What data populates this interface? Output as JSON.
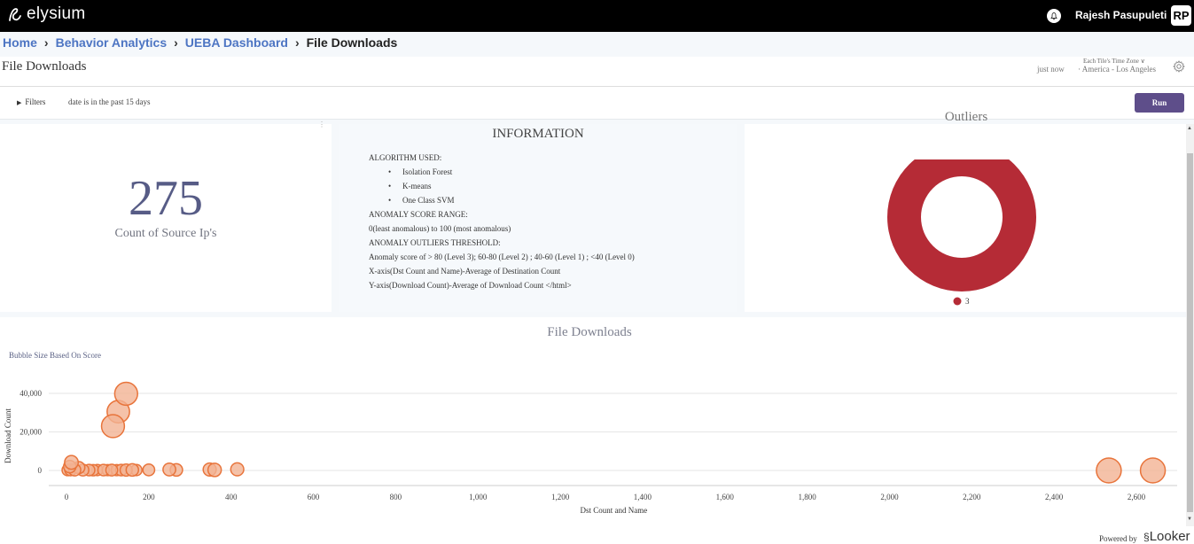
{
  "app": {
    "name": "elysium",
    "user_name": "Rajesh Pasupuleti",
    "user_initials": "RP"
  },
  "breadcrumb": [
    {
      "label": "Home"
    },
    {
      "label": "Behavior Analytics"
    },
    {
      "label": "UEBA Dashboard"
    },
    {
      "label": "File Downloads"
    }
  ],
  "breadcrumb_separator": "›",
  "dashboard": {
    "title": "File Downloads",
    "tz_label": "Each Tile's Time Zone ∨",
    "updated": "just now",
    "tz_value": "·  America - Los Angeles"
  },
  "filters": {
    "toggle_label": "Filters",
    "summary": "date is in the past 15 days",
    "run_label": "Run"
  },
  "kpi": {
    "value": "275",
    "label": "Count of Source Ip's"
  },
  "info": {
    "title": "INFORMATION",
    "algo_heading": "ALGORITHM USED:",
    "algorithms": [
      "Isolation Forest",
      "K-means",
      "One Class SVM"
    ],
    "range_heading": "ANOMALY SCORE RANGE:",
    "range_text": "0(least anomalous) to 100 (most anomalous)",
    "threshold_heading": "ANOMALY OUTLIERS THRESHOLD:",
    "threshold_text": "Anomaly score of > 80 (Level 3); 60-80 (Level 2) ; 40-60 (Level 1) ; <40 (Level 0)",
    "x_axis_text": "X-axis(Dst Count and Name)-Average of Destination Count",
    "y_axis_text": "Y-axis(Download Count)-Average of Download Count </html>"
  },
  "outliers": {
    "title": "Outliers"
  },
  "scatter": {
    "title": "File Downloads",
    "bubble_note": "Bubble Size Based On Score"
  },
  "footer": {
    "powered_by": "Powered by",
    "brand": "Looker"
  },
  "colors": {
    "topbar": "#000000",
    "link": "#4d75c3",
    "run": "#5e4e8a",
    "donut": "#b52b36",
    "bubble_fill": "#f3b394",
    "bubble_stroke": "#e8743b",
    "kpi": "#575c86"
  },
  "chart_data": [
    {
      "type": "pie",
      "title": "Outliers",
      "categories": [
        "3"
      ],
      "values": [
        1
      ],
      "legend_position": "bottom"
    },
    {
      "type": "scatter",
      "title": "File Downloads",
      "xlabel": "Dst Count and Name",
      "ylabel": "Download Count",
      "x_ticks": [
        0,
        200,
        400,
        600,
        800,
        1000,
        1200,
        1400,
        1600,
        1800,
        2000,
        2200,
        2400,
        2600
      ],
      "x_tick_labels": [
        "0",
        "200",
        "400",
        "600",
        "800",
        "1,000",
        "1,200",
        "1,400",
        "1,600",
        "1,800",
        "2,000",
        "2,200",
        "2,400",
        "2,600"
      ],
      "y_ticks": [
        0,
        20000,
        40000
      ],
      "y_tick_labels": [
        "0",
        "20,000",
        "40,000"
      ],
      "xlim": [
        -10,
        2700
      ],
      "ylim": [
        -4000,
        46000
      ],
      "grid": true,
      "size_encoding": "score",
      "points": [
        {
          "x": 145,
          "y": 39800,
          "s": 88
        },
        {
          "x": 126,
          "y": 30500,
          "s": 85
        },
        {
          "x": 113,
          "y": 23000,
          "s": 88
        },
        {
          "x": 12,
          "y": 4200,
          "s": 30
        },
        {
          "x": 8,
          "y": 2000,
          "s": 22
        },
        {
          "x": 30,
          "y": 1500,
          "s": 20
        },
        {
          "x": 3,
          "y": 200,
          "s": 15
        },
        {
          "x": 10,
          "y": 300,
          "s": 18
        },
        {
          "x": 20,
          "y": 300,
          "s": 20
        },
        {
          "x": 40,
          "y": 200,
          "s": 18
        },
        {
          "x": 55,
          "y": 200,
          "s": 16
        },
        {
          "x": 65,
          "y": 150,
          "s": 15
        },
        {
          "x": 75,
          "y": 200,
          "s": 14
        },
        {
          "x": 90,
          "y": 200,
          "s": 16
        },
        {
          "x": 100,
          "y": 150,
          "s": 14
        },
        {
          "x": 110,
          "y": 200,
          "s": 18
        },
        {
          "x": 122,
          "y": 150,
          "s": 14
        },
        {
          "x": 133,
          "y": 200,
          "s": 16
        },
        {
          "x": 145,
          "y": 200,
          "s": 20
        },
        {
          "x": 160,
          "y": 300,
          "s": 22
        },
        {
          "x": 170,
          "y": 200,
          "s": 14
        },
        {
          "x": 200,
          "y": 300,
          "s": 18
        },
        {
          "x": 250,
          "y": 500,
          "s": 24
        },
        {
          "x": 267,
          "y": 300,
          "s": 22
        },
        {
          "x": 348,
          "y": 500,
          "s": 26
        },
        {
          "x": 360,
          "y": 300,
          "s": 28
        },
        {
          "x": 415,
          "y": 600,
          "s": 26
        },
        {
          "x": 2533,
          "y": 0,
          "s": 100
        },
        {
          "x": 2640,
          "y": 0,
          "s": 100
        }
      ]
    }
  ]
}
